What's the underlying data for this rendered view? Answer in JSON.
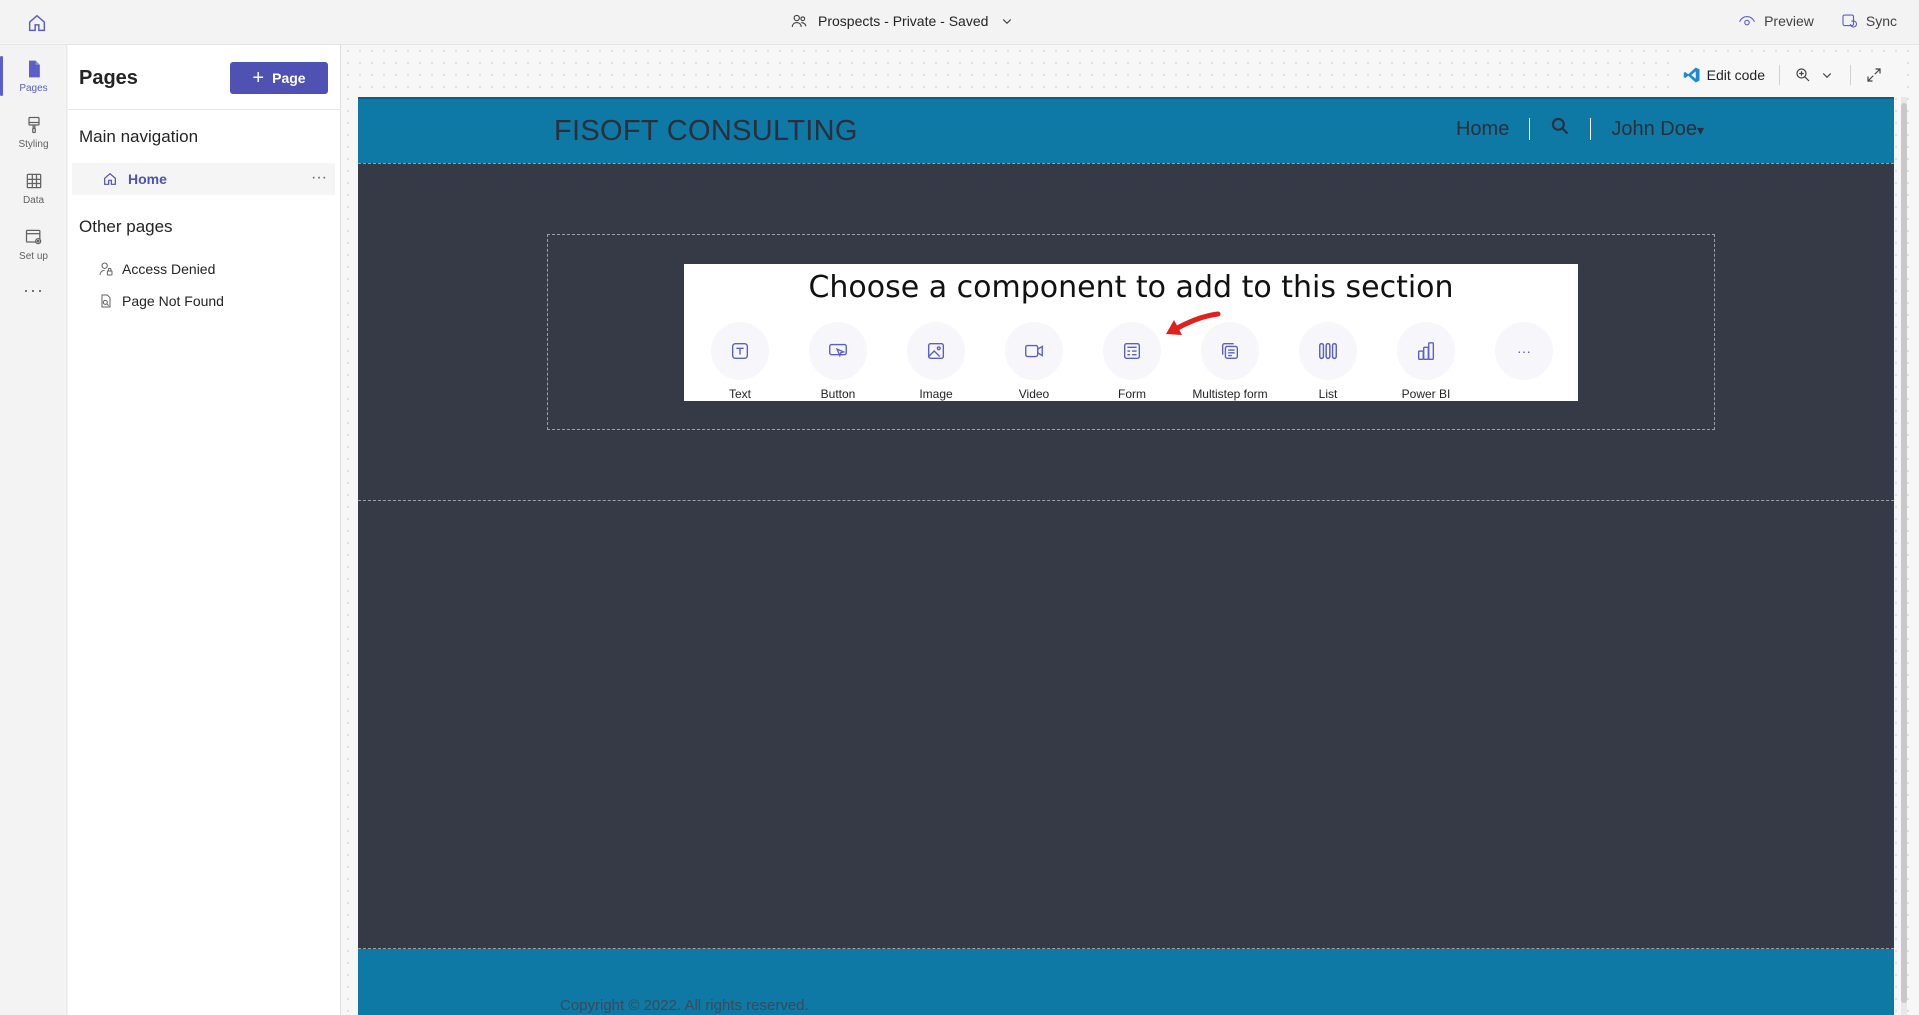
{
  "topbar": {
    "site_name": "Prospects - Private - Saved",
    "preview_label": "Preview",
    "sync_label": "Sync"
  },
  "rail": {
    "items": [
      {
        "label": "Pages",
        "icon": "page-icon"
      },
      {
        "label": "Styling",
        "icon": "brush-icon"
      },
      {
        "label": "Data",
        "icon": "table-icon"
      },
      {
        "label": "Set up",
        "icon": "settings-window-icon"
      }
    ],
    "more": "···"
  },
  "panel": {
    "title": "Pages",
    "add_label": "Page",
    "main_nav_heading": "Main navigation",
    "main_nav": [
      {
        "label": "Home",
        "menu": "···"
      }
    ],
    "other_heading": "Other pages",
    "other_pages": [
      {
        "label": "Access Denied"
      },
      {
        "label": "Page Not Found"
      }
    ]
  },
  "canvas_tools": {
    "edit_code_label": "Edit code"
  },
  "site": {
    "brand": "FISOFT CONSULTING",
    "nav_home": "Home",
    "nav_user": "John Doe",
    "user_caret": "▾",
    "picker_title": "Choose a component to add to this section",
    "components": [
      {
        "label": "Text",
        "icon": "text-icon"
      },
      {
        "label": "Button",
        "icon": "button-cursor-icon"
      },
      {
        "label": "Image",
        "icon": "image-icon"
      },
      {
        "label": "Video",
        "icon": "video-icon"
      },
      {
        "label": "Form",
        "icon": "form-icon"
      },
      {
        "label": "Multistep form",
        "icon": "multistep-form-icon"
      },
      {
        "label": "List",
        "icon": "list-columns-icon"
      },
      {
        "label": "Power BI",
        "icon": "power-bi-icon"
      },
      {
        "label": "",
        "icon": "more-icon",
        "glyph": "···"
      }
    ],
    "copyright": "Copyright © 2022. All rights reserved."
  },
  "colors": {
    "accent": "#5b5fc7",
    "primary_button": "#4f52b2",
    "site_header": "#0e79a4",
    "site_body": "#363a47",
    "annotation_arrow": "#e0201c"
  }
}
